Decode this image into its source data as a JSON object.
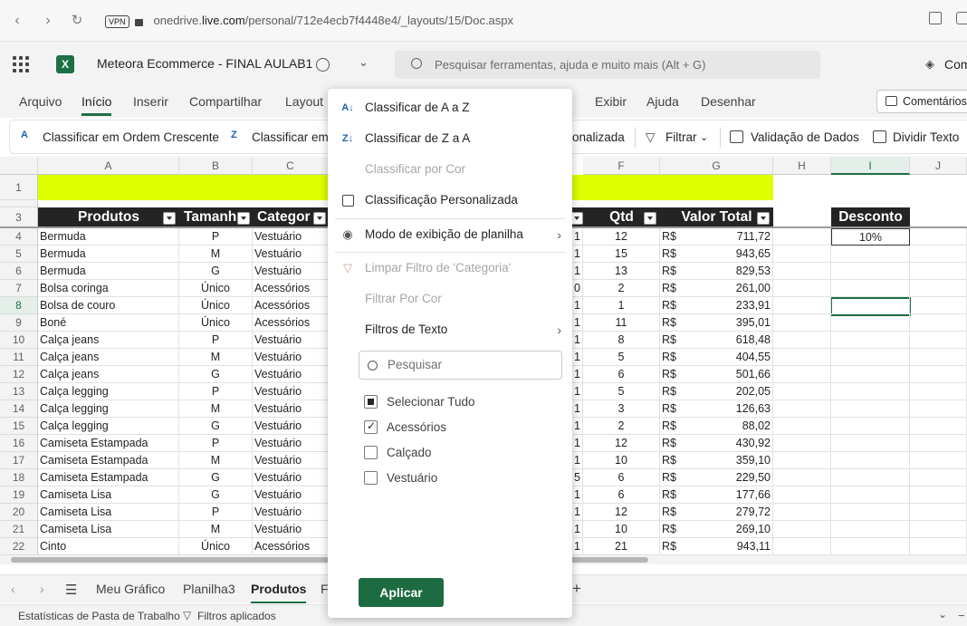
{
  "browser": {
    "url_pre": "onedrive.",
    "url_host": "live.com",
    "url_path": "/personal/712e4ecb7f4448e4/_layouts/15/Doc.aspx",
    "vpn": "VPN"
  },
  "app": {
    "title": "Meteora Ecommerce - FINAL AULAB1",
    "search_placeholder": "Pesquisar ferramentas, ajuda e muito mais (Alt + G)",
    "premium": "Com"
  },
  "tabs": [
    "Arquivo",
    "Início",
    "Inserir",
    "Compartilhar",
    "Layout",
    "Exibir",
    "Ajuda",
    "Desenhar"
  ],
  "comments_btn": "Comentários",
  "ribbon": {
    "sort_asc": "Classificar em Ordem Crescente",
    "sort_desc": "Classificar em",
    "custom": "onalizada",
    "filter": "Filtrar",
    "validation": "Validação de Dados",
    "split": "Dividir Texto"
  },
  "columns": [
    "A",
    "B",
    "C",
    "F",
    "G",
    "H",
    "I",
    "J"
  ],
  "headers": {
    "produtos": "Produtos",
    "tamanho": "Tamanh",
    "categoria": "Categor",
    "qtd": "Qtd",
    "valor_total": "Valor Total",
    "desconto": "Desconto"
  },
  "discount_value": "10%",
  "rows": [
    {
      "n": "4",
      "produto": "Bermuda",
      "tam": "P",
      "cat": "Vestuário",
      "e": "1",
      "qtd": "12",
      "rs": "R$",
      "valor": "711,72"
    },
    {
      "n": "5",
      "produto": "Bermuda",
      "tam": "M",
      "cat": "Vestuário",
      "e": "1",
      "qtd": "15",
      "rs": "R$",
      "valor": "943,65"
    },
    {
      "n": "6",
      "produto": "Bermuda",
      "tam": "G",
      "cat": "Vestuário",
      "e": "1",
      "qtd": "13",
      "rs": "R$",
      "valor": "829,53"
    },
    {
      "n": "7",
      "produto": "Bolsa coringa",
      "tam": "Único",
      "cat": "Acessórios",
      "e": "0",
      "qtd": "2",
      "rs": "R$",
      "valor": "261,00"
    },
    {
      "n": "8",
      "produto": "Bolsa de couro",
      "tam": "Único",
      "cat": "Acessórios",
      "e": "1",
      "qtd": "1",
      "rs": "R$",
      "valor": "233,91"
    },
    {
      "n": "9",
      "produto": "Boné",
      "tam": "Único",
      "cat": "Acessórios",
      "e": "1",
      "qtd": "11",
      "rs": "R$",
      "valor": "395,01"
    },
    {
      "n": "10",
      "produto": "Calça jeans",
      "tam": "P",
      "cat": "Vestuário",
      "e": "1",
      "qtd": "8",
      "rs": "R$",
      "valor": "618,48"
    },
    {
      "n": "11",
      "produto": "Calça jeans",
      "tam": "M",
      "cat": "Vestuário",
      "e": "1",
      "qtd": "5",
      "rs": "R$",
      "valor": "404,55"
    },
    {
      "n": "12",
      "produto": "Calça jeans",
      "tam": "G",
      "cat": "Vestuário",
      "e": "1",
      "qtd": "6",
      "rs": "R$",
      "valor": "501,66"
    },
    {
      "n": "13",
      "produto": "Calça legging",
      "tam": "P",
      "cat": "Vestuário",
      "e": "1",
      "qtd": "5",
      "rs": "R$",
      "valor": "202,05"
    },
    {
      "n": "14",
      "produto": "Calça legging",
      "tam": "M",
      "cat": "Vestuário",
      "e": "1",
      "qtd": "3",
      "rs": "R$",
      "valor": "126,63"
    },
    {
      "n": "15",
      "produto": "Calça legging",
      "tam": "G",
      "cat": "Vestuário",
      "e": "1",
      "qtd": "2",
      "rs": "R$",
      "valor": "88,02"
    },
    {
      "n": "16",
      "produto": "Camiseta Estampada",
      "tam": "P",
      "cat": "Vestuário",
      "e": "1",
      "qtd": "12",
      "rs": "R$",
      "valor": "430,92"
    },
    {
      "n": "17",
      "produto": "Camiseta Estampada",
      "tam": "M",
      "cat": "Vestuário",
      "e": "1",
      "qtd": "10",
      "rs": "R$",
      "valor": "359,10"
    },
    {
      "n": "18",
      "produto": "Camiseta Estampada",
      "tam": "G",
      "cat": "Vestuário",
      "e": "5",
      "qtd": "6",
      "rs": "R$",
      "valor": "229,50"
    },
    {
      "n": "19",
      "produto": "Camiseta Lisa",
      "tam": "G",
      "cat": "Vestuário",
      "e": "1",
      "qtd": "6",
      "rs": "R$",
      "valor": "177,66"
    },
    {
      "n": "20",
      "produto": "Camiseta Lisa",
      "tam": "P",
      "cat": "Vestuário",
      "e": "1",
      "qtd": "12",
      "rs": "R$",
      "valor": "279,72"
    },
    {
      "n": "21",
      "produto": "Camiseta Lisa",
      "tam": "M",
      "cat": "Vestuário",
      "e": "1",
      "qtd": "10",
      "rs": "R$",
      "valor": "269,10"
    },
    {
      "n": "22",
      "produto": "Cinto",
      "tam": "Único",
      "cat": "Acessórios",
      "e": "1",
      "qtd": "21",
      "rs": "R$",
      "valor": "943,11"
    }
  ],
  "dropdown": {
    "sort_az": "Classificar de A a Z",
    "sort_za": "Classificar de Z a A",
    "sort_color": "Classificar por Cor",
    "custom_sort": "Classificação Personalizada",
    "view_mode": "Modo de exibição de planilha",
    "clear_filter": "Limpar Filtro de 'Categoria'",
    "filter_color": "Filtrar Por Cor",
    "text_filters": "Filtros de Texto",
    "search_placeholder": "Pesquisar",
    "select_all": "Selecionar Tudo",
    "options": [
      {
        "label": "Acessórios",
        "checked": true
      },
      {
        "label": "Calçado",
        "checked": false
      },
      {
        "label": "Vestuário",
        "checked": false
      }
    ],
    "apply": "Aplicar"
  },
  "sheets": [
    "Meu Gráfico",
    "Planilha3",
    "Produtos",
    "F"
  ],
  "active_sheet": "Produtos",
  "status": {
    "stats": "Estatísticas de Pasta de Trabalho",
    "filters": "Filtros aplicados"
  },
  "colors": {
    "accent": "#1d7044",
    "header_fill": "#242424",
    "title_fill": "#ddff00"
  }
}
